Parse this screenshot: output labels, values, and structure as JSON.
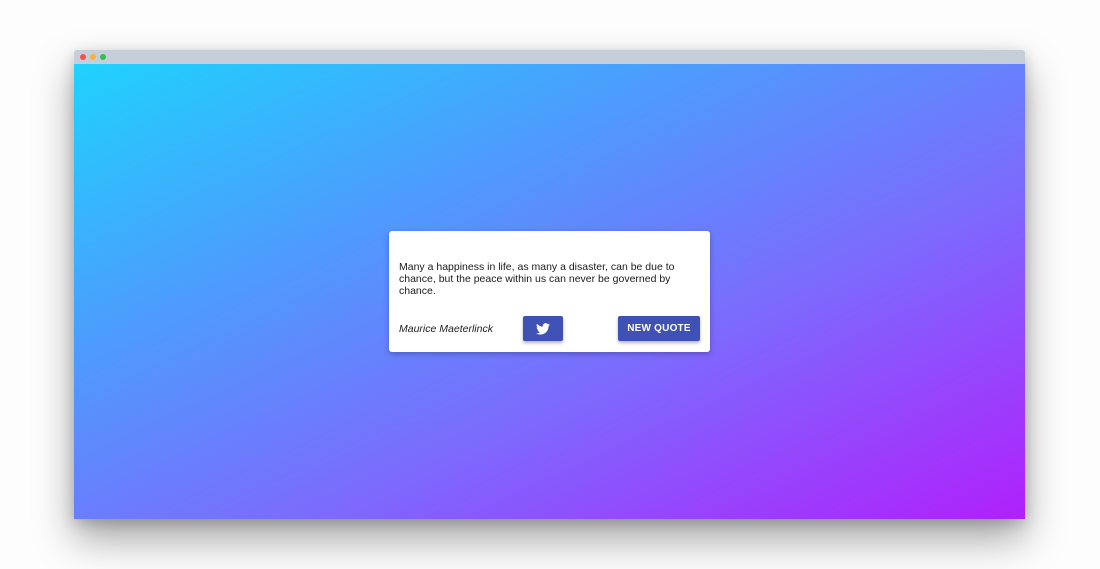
{
  "window": {
    "controls": [
      "close",
      "minimize",
      "maximize"
    ]
  },
  "quote_card": {
    "text": "Many a happiness in life, as many a disaster, can be due to chance, but the peace within us can never be governed by chance.",
    "author": "Maurice Maeterlinck",
    "tweet_icon": "twitter-bird-icon",
    "new_quote_label": "NEW QUOTE"
  },
  "colors": {
    "button": "#3f51b5",
    "gradient_start": "#1fd2fd",
    "gradient_end": "#b020fc"
  }
}
